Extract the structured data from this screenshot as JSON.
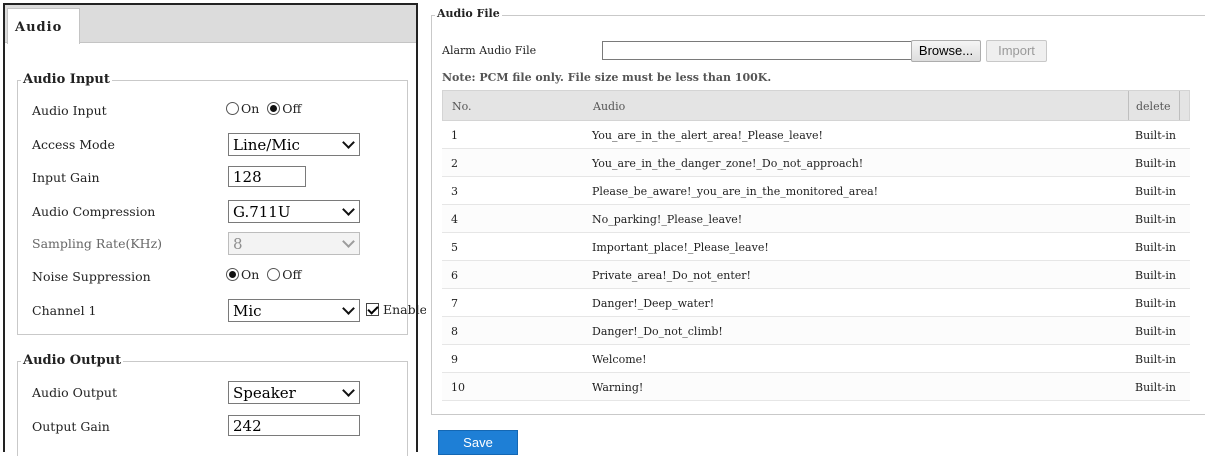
{
  "audio_tab": {
    "label": "Audio"
  },
  "audio_input": {
    "legend": "Audio Input",
    "audio_input": {
      "label": "Audio Input",
      "on_label": "On",
      "off_label": "Off",
      "selected": "Off"
    },
    "access_mode": {
      "label": "Access Mode",
      "value": "Line/Mic"
    },
    "input_gain": {
      "label": "Input Gain",
      "value": "128"
    },
    "audio_compression": {
      "label": "Audio Compression",
      "value": "G.711U"
    },
    "sampling_rate": {
      "label": "Sampling Rate(KHz)",
      "value": "8",
      "disabled": true
    },
    "noise_suppression": {
      "label": "Noise Suppression",
      "on_label": "On",
      "off_label": "Off",
      "selected": "On"
    },
    "channel1": {
      "label": "Channel 1",
      "value": "Mic",
      "enable_label": "Enable",
      "enable_checked": true
    }
  },
  "audio_output": {
    "legend": "Audio Output",
    "audio_output": {
      "label": "Audio Output",
      "value": "Speaker"
    },
    "output_gain": {
      "label": "Output Gain",
      "value": "242"
    }
  },
  "audio_file": {
    "legend": "Audio File",
    "alarm_label": "Alarm Audio File",
    "file_path": "",
    "browse_label": "Browse...",
    "import_label": "Import",
    "note": "Note: PCM file only. File size must be less than 100K.",
    "columns": {
      "no": "No.",
      "audio": "Audio",
      "delete": "delete"
    },
    "rows": [
      {
        "no": "1",
        "audio": "You_are_in_the_alert_area!_Please_leave!",
        "delete": "Built-in"
      },
      {
        "no": "2",
        "audio": "You_are_in_the_danger_zone!_Do_not_approach!",
        "delete": "Built-in"
      },
      {
        "no": "3",
        "audio": "Please_be_aware!_you_are_in_the_monitored_area!",
        "delete": "Built-in"
      },
      {
        "no": "4",
        "audio": "No_parking!_Please_leave!",
        "delete": "Built-in"
      },
      {
        "no": "5",
        "audio": "Important_place!_Please_leave!",
        "delete": "Built-in"
      },
      {
        "no": "6",
        "audio": "Private_area!_Do_not_enter!",
        "delete": "Built-in"
      },
      {
        "no": "7",
        "audio": "Danger!_Deep_water!",
        "delete": "Built-in"
      },
      {
        "no": "8",
        "audio": "Danger!_Do_not_climb!",
        "delete": "Built-in"
      },
      {
        "no": "9",
        "audio": "Welcome!",
        "delete": "Built-in"
      },
      {
        "no": "10",
        "audio": "Warning!",
        "delete": "Built-in"
      }
    ]
  },
  "save_label": "Save",
  "colors": {
    "save_button": "#1e7fd6",
    "tab_strip": "#dcdcdc",
    "table_header": "#e4e4e4"
  }
}
